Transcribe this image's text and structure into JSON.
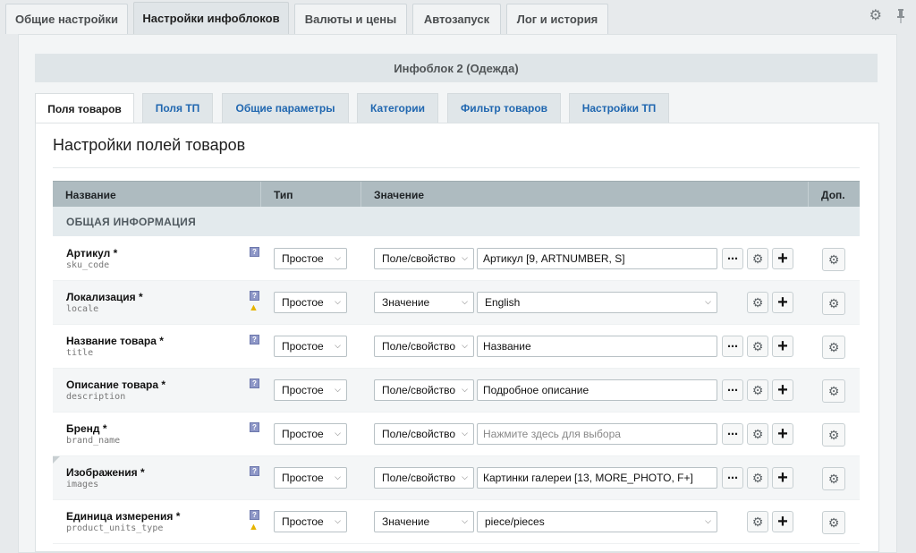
{
  "top_tabs": [
    {
      "label": "Общие настройки",
      "active": false
    },
    {
      "label": "Настройки инфоблоков",
      "active": true
    },
    {
      "label": "Валюты и цены",
      "active": false
    },
    {
      "label": "Автозапуск",
      "active": false
    },
    {
      "label": "Лог и история",
      "active": false
    }
  ],
  "iblock_title": "Инфоблок 2 (Одежда)",
  "inner_tabs": [
    {
      "label": "Поля товаров",
      "active": true
    },
    {
      "label": "Поля ТП",
      "active": false
    },
    {
      "label": "Общие параметры",
      "active": false
    },
    {
      "label": "Категории",
      "active": false
    },
    {
      "label": "Фильтр товаров",
      "active": false
    },
    {
      "label": "Настройки ТП",
      "active": false
    }
  ],
  "content_title": "Настройки полей товаров",
  "table": {
    "columns": {
      "name": "Название",
      "type": "Тип",
      "value": "Значение",
      "extra": "Доп."
    },
    "section": "ОБЩАЯ ИНФОРМАЦИЯ",
    "rows": [
      {
        "name": "Артикул *",
        "code": "sku_code",
        "type": "Простое",
        "source": "Поле/свойство",
        "value": "Артикул [9, ARTNUMBER, S]",
        "warning": false,
        "value_is_select": false,
        "placeholder": false
      },
      {
        "name": "Локализация *",
        "code": "locale",
        "type": "Простое",
        "source": "Значение",
        "value": "English",
        "warning": true,
        "value_is_select": true,
        "placeholder": false
      },
      {
        "name": "Название товара *",
        "code": "title",
        "type": "Простое",
        "source": "Поле/свойство",
        "value": "Название",
        "warning": false,
        "value_is_select": false,
        "placeholder": false
      },
      {
        "name": "Описание товара *",
        "code": "description",
        "type": "Простое",
        "source": "Поле/свойство",
        "value": "Подробное описание",
        "warning": false,
        "value_is_select": false,
        "placeholder": false
      },
      {
        "name": "Бренд *",
        "code": "brand_name",
        "type": "Простое",
        "source": "Поле/свойство",
        "value": "Нажмите здесь для выбора",
        "warning": false,
        "value_is_select": false,
        "placeholder": true
      },
      {
        "name": "Изображения *",
        "code": "images",
        "type": "Простое",
        "source": "Поле/свойство",
        "value": "Картинки галереи [13, MORE_PHOTO, F+]",
        "warning": false,
        "value_is_select": false,
        "placeholder": false
      },
      {
        "name": "Единица измерения *",
        "code": "product_units_type",
        "type": "Простое",
        "source": "Значение",
        "value": "piece/pieces",
        "warning": true,
        "value_is_select": true,
        "placeholder": false
      }
    ]
  },
  "icons": {
    "settings": "gear-icon",
    "pin": "pin-icon",
    "help": "help-icon",
    "warning": "warning-icon",
    "more": "ellipsis-icon",
    "add": "plus-icon",
    "dropdown": "chevron-down-icon"
  }
}
